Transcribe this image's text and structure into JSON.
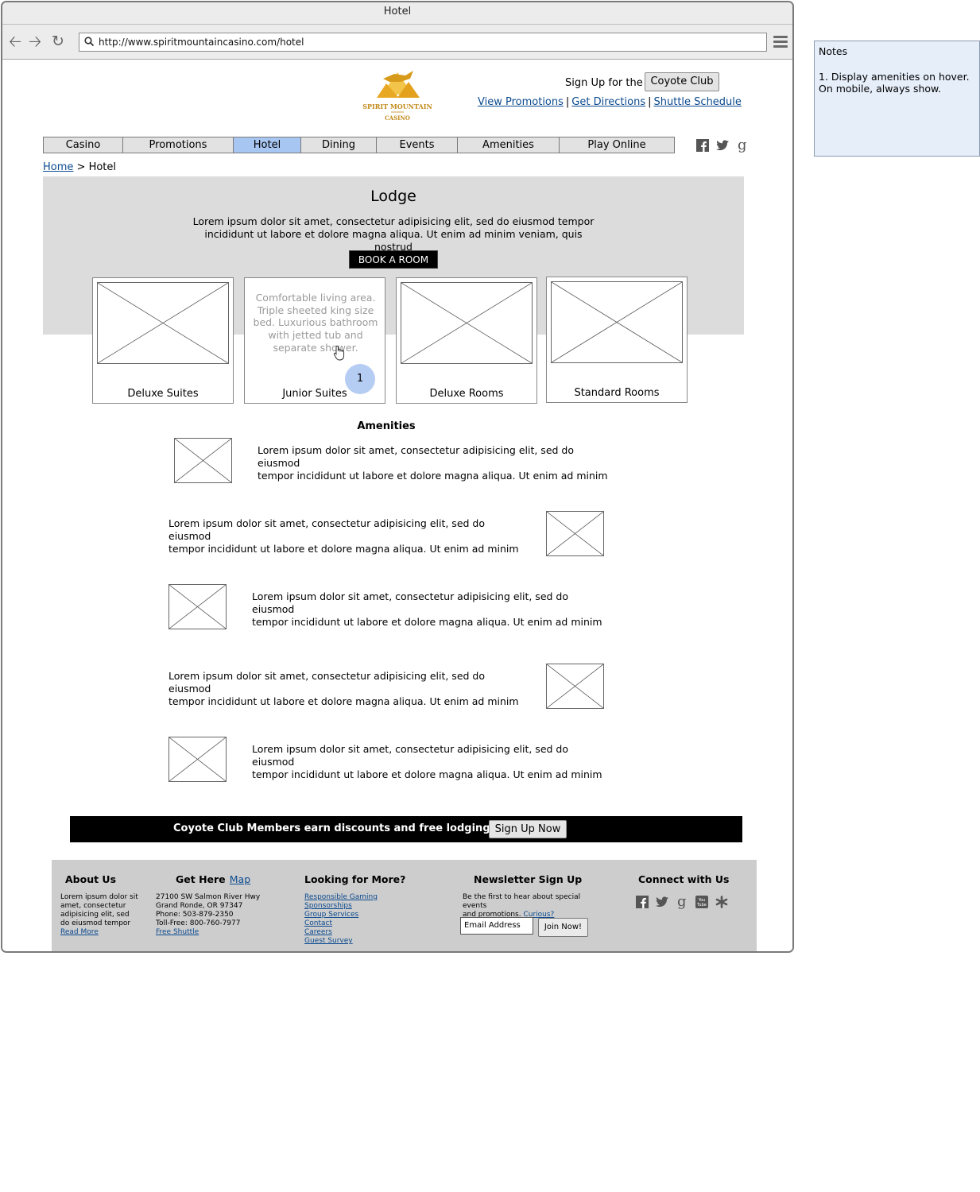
{
  "window": {
    "title": "Hotel"
  },
  "browser": {
    "url": "http://www.spiritmountaincasino.com/hotel"
  },
  "header": {
    "logo_text": "SPIRIT MOUNTAIN CASINO",
    "signup_prefix": "Sign Up for the",
    "coyote_button": "Coyote Club",
    "links": [
      "View Promotions",
      "Get Directions",
      "Shuttle Schedule"
    ],
    "link_separator": "|"
  },
  "nav": {
    "items": [
      "Casino",
      "Promotions",
      "Hotel",
      "Dining",
      "Events",
      "Amenities",
      "Play Online"
    ],
    "active": "Hotel",
    "social": [
      "facebook-icon",
      "twitter-icon",
      "google-icon"
    ]
  },
  "breadcrumb": {
    "home": "Home",
    "sep": ">",
    "current": "Hotel"
  },
  "hero": {
    "title": "Lodge",
    "intro_line1": "Lorem ipsum dolor sit amet, consectetur adipisicing elit, sed do eiusmod tempor",
    "intro_line2": "incididunt ut labore et dolore magna aliqua. Ut enim ad minim veniam, quis nostrud",
    "book_button": "BOOK A ROOM"
  },
  "rooms": [
    {
      "label": "Deluxe Suites"
    },
    {
      "label": "Junior Suites",
      "hover_text": "Comfortable living area. Triple sheeted king size bed. Luxurious bathroom with jetted tub and separate shower.",
      "badge": "1"
    },
    {
      "label": "Deluxe Rooms"
    },
    {
      "label": "Standard Rooms"
    }
  ],
  "amenities": {
    "title": "Amenities",
    "text": "Lorem ipsum dolor sit amet, consectetur adipisicing elit, sed do eiusmod tempor incididunt ut labore et dolore magna aliqua. Ut enim ad minim",
    "line1": "Lorem ipsum dolor sit amet, consectetur adipisicing elit, sed do eiusmod",
    "line2": "tempor incididunt ut labore et dolore magna aliqua. Ut enim ad minim"
  },
  "banner": {
    "text": "Coyote Club Members earn discounts and free lodging!",
    "button": "Sign Up Now"
  },
  "footer": {
    "about": {
      "title": "About Us",
      "lines": [
        "Lorem ipsum dolor sit",
        "amet, consectetur",
        "adipisicing elit, sed",
        "do eiusmod tempor"
      ],
      "read_more": "Read More"
    },
    "get_here": {
      "title": "Get Here",
      "map_link": "Map",
      "lines": [
        "27100 SW Salmon River Hwy",
        "Grand Ronde, OR 97347",
        "Phone: 503-879-2350",
        "Toll-Free: 800-760-7977"
      ],
      "shuttle_link": "Free Shuttle"
    },
    "looking": {
      "title": "Looking for More?",
      "links": [
        "Responsible Gaming",
        "Sponsorships",
        "Group Services",
        "Contact",
        "Careers",
        "Guest Survey"
      ]
    },
    "newsletter": {
      "title": "Newsletter Sign Up",
      "line1": "Be the first to hear about special events",
      "line2": "and promotions.",
      "curious": "Curious?",
      "email_placeholder": "Email Address",
      "join_button": "Join Now!"
    },
    "connect": {
      "title": "Connect with Us",
      "icons": [
        "facebook-icon",
        "twitter-icon",
        "google-icon",
        "youtube-icon",
        "yelp-icon"
      ]
    }
  },
  "notes": {
    "title": "Notes",
    "body": "1. Display amenities on hover. On mobile, always show."
  }
}
